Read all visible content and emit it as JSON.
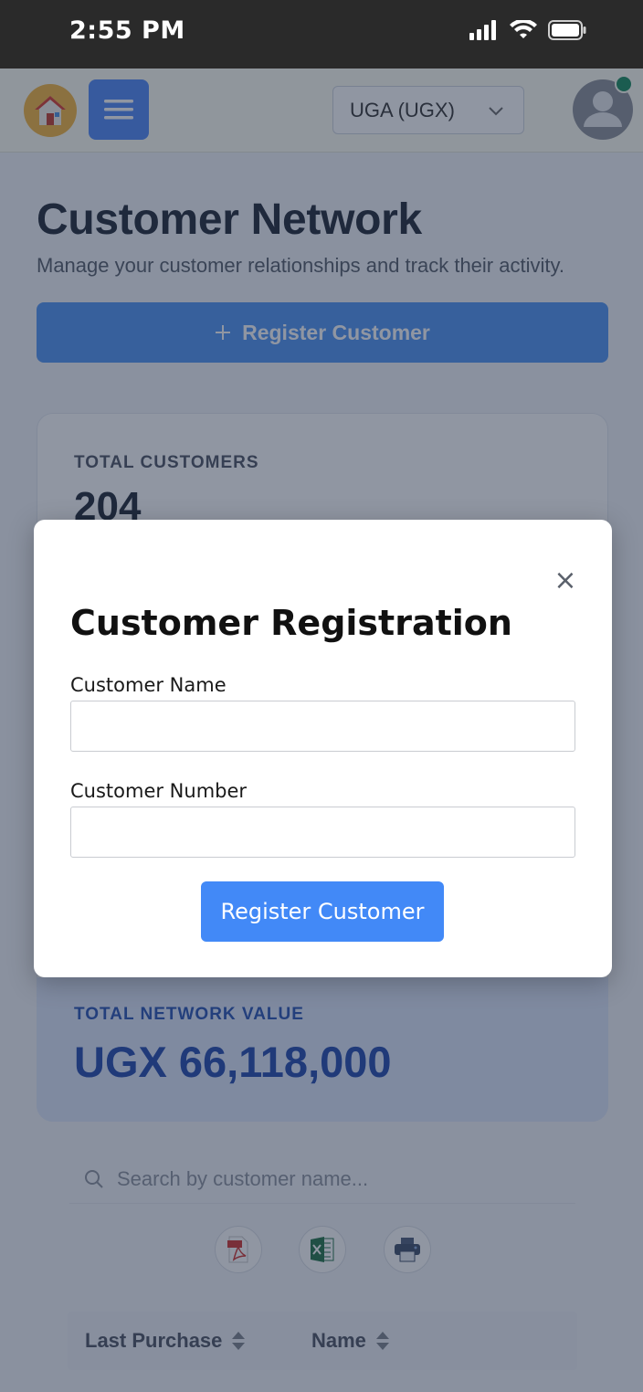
{
  "status_bar": {
    "time": "2:55 PM",
    "icons": [
      "signal-icon",
      "wifi-icon",
      "battery-icon"
    ]
  },
  "nav": {
    "home_icon": "home-icon",
    "menu_icon": "hamburger-menu-icon",
    "currency_selected": "UGA (UGX)",
    "avatar_icon": "user-avatar-icon",
    "online_status_color": "#148a5a"
  },
  "page": {
    "title": "Customer Network",
    "subtitle": "Manage your customer relationships and track their activity.",
    "register_button_label": "Register Customer",
    "register_button_icon": "plus-icon"
  },
  "stats": {
    "total_customers_label": "TOTAL CUSTOMERS",
    "total_customers_value": "204",
    "total_network_value_label": "TOTAL NETWORK VALUE",
    "total_network_value": "UGX 66,118,000"
  },
  "search": {
    "placeholder": "Search by customer name..."
  },
  "export_buttons": [
    {
      "name": "pdf-export-icon"
    },
    {
      "name": "excel-export-icon"
    },
    {
      "name": "print-icon"
    }
  ],
  "table": {
    "columns": [
      "Last Purchase",
      "Name"
    ]
  },
  "modal": {
    "title": "Customer Registration",
    "close_label": "×",
    "name_label": "Customer Name",
    "name_value": "",
    "number_label": "Customer Number",
    "number_value": "",
    "submit_label": "Register Customer"
  },
  "colors": {
    "accent": "#4289f7",
    "network_value": "#1e46ad",
    "status_bar": "#2a2a2a",
    "nav_bg": "#fffef2"
  }
}
